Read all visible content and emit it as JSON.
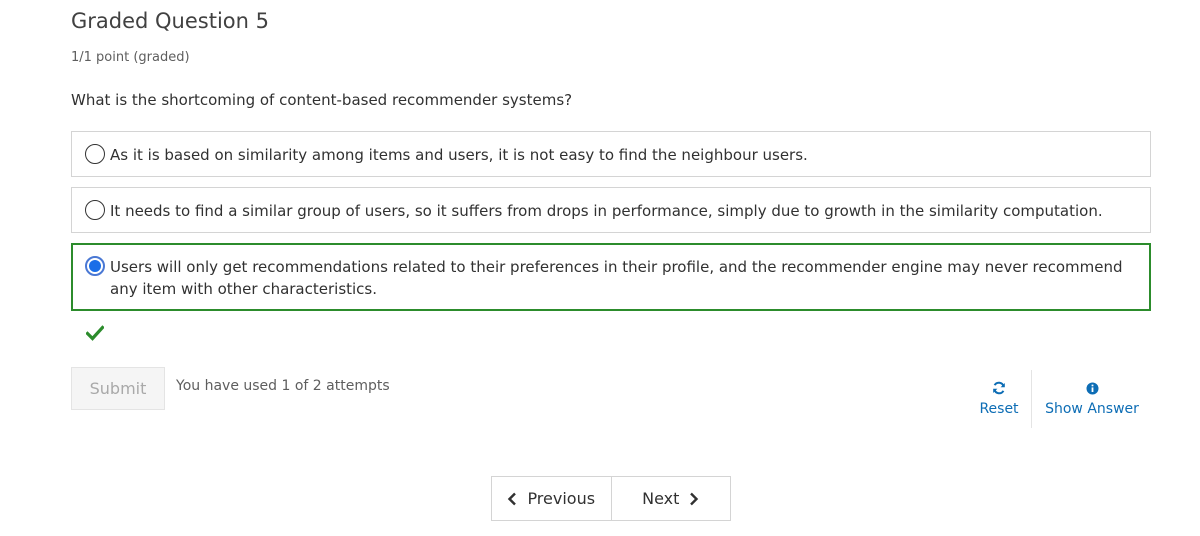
{
  "question": {
    "title": "Graded Question 5",
    "points": "1/1 point (graded)",
    "prompt": "What is the shortcoming of content-based recommender systems?"
  },
  "choices": [
    {
      "text": "As it is based on similarity among items and users, it is not easy to find the neighbour users.",
      "selected": false
    },
    {
      "text": "It needs to find a similar group of users, so it suffers from drops in performance, simply due to growth in the similarity computation.",
      "selected": false
    },
    {
      "text": "Users will only get recommendations related to their preferences in their profile, and the recommender engine may never recommend any item with other characteristics.",
      "selected": true,
      "correct": true
    }
  ],
  "status": {
    "icon": "checkmark-icon",
    "color": "#2c8c2c"
  },
  "actions": {
    "submit_label": "Submit",
    "attempts_text": "You have used 1 of 2 attempts",
    "reset_label": "Reset",
    "show_answer_label": "Show Answer",
    "link_color": "#0d6db5"
  },
  "navigation": {
    "previous_label": "Previous",
    "next_label": "Next"
  }
}
